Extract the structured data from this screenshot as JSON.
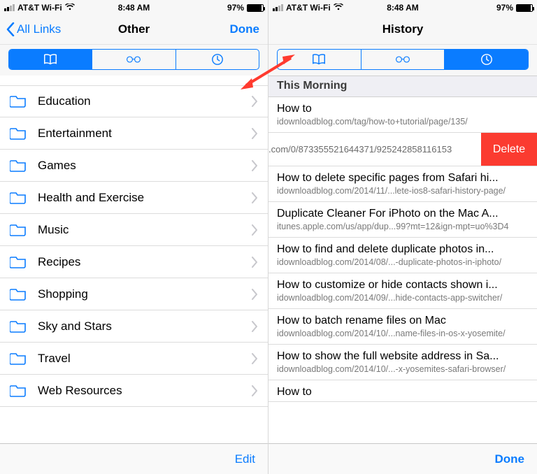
{
  "status": {
    "carrier": "AT&T Wi-Fi",
    "time": "8:48 AM",
    "battery_pct": "97%",
    "battery_fill_width": "92%"
  },
  "left": {
    "back_label": "All Links",
    "title": "Other",
    "done": "Done",
    "seg_active_index": 0,
    "folders": [
      "Education",
      "Entertainment",
      "Games",
      "Health and Exercise",
      "Music",
      "Recipes",
      "Shopping",
      "Sky and Stars",
      "Travel",
      "Web Resources"
    ],
    "toolbar_action": "Edit"
  },
  "right": {
    "title": "History",
    "seg_active_index": 2,
    "section_header": "This Morning",
    "swiped_row": {
      "visible_url_fragment": ".com/0/873355521644371/925242858116153",
      "delete_label": "Delete"
    },
    "items": [
      {
        "title": "How to",
        "url": "idownloadblog.com/tag/how-to+tutorial/page/135/"
      },
      {
        "title": "How to delete specific pages from Safari hi...",
        "url": "idownloadblog.com/2014/11/...lete-ios8-safari-history-page/"
      },
      {
        "title": "Duplicate Cleaner For iPhoto on the Mac A...",
        "url": "itunes.apple.com/us/app/dup...99?mt=12&ign-mpt=uo%3D4"
      },
      {
        "title": "How to find and delete duplicate photos in...",
        "url": "idownloadblog.com/2014/08/...-duplicate-photos-in-iphoto/"
      },
      {
        "title": "How to customize or hide contacts shown i...",
        "url": "idownloadblog.com/2014/09/...hide-contacts-app-switcher/"
      },
      {
        "title": "How to batch rename files on Mac",
        "url": "idownloadblog.com/2014/10/...name-files-in-os-x-yosemite/"
      },
      {
        "title": "How to show the full website address in Sa...",
        "url": "idownloadblog.com/2014/10/...-x-yosemites-safari-browser/"
      },
      {
        "title": "How to",
        "url": ""
      }
    ],
    "toolbar_action": "Done"
  },
  "arrow_color": "#ff3a2f"
}
